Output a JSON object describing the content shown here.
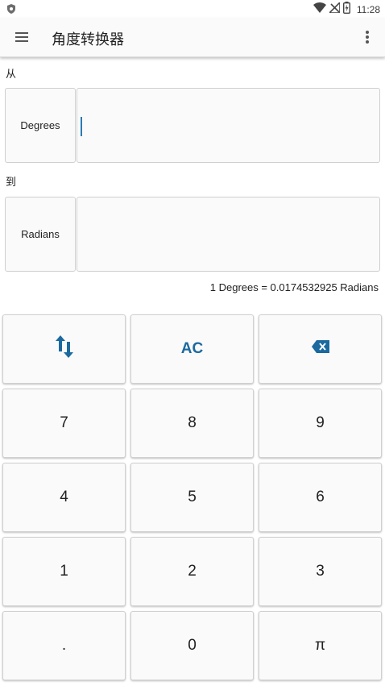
{
  "status_bar": {
    "time": "11:28"
  },
  "app_bar": {
    "title": "角度转换器"
  },
  "converter": {
    "from_label": "从",
    "from_unit": "Degrees",
    "from_value": "",
    "to_label": "到",
    "to_unit": "Radians",
    "to_value": "",
    "result": "1 Degrees = 0.0174532925 Radians"
  },
  "keypad": {
    "clear_label": "AC",
    "digits": [
      "7",
      "8",
      "9",
      "4",
      "5",
      "6",
      "1",
      "2",
      "3"
    ],
    "decimal_label": ".",
    "zero_label": "0",
    "pi_label": "π"
  },
  "colors": {
    "accent": "#1a6aa0",
    "caret": "#2a7bb5"
  },
  "icons": {
    "menu": "menu-icon",
    "overflow": "more-vert-icon",
    "swap": "swap-vertical-icon",
    "backspace": "backspace-icon"
  }
}
